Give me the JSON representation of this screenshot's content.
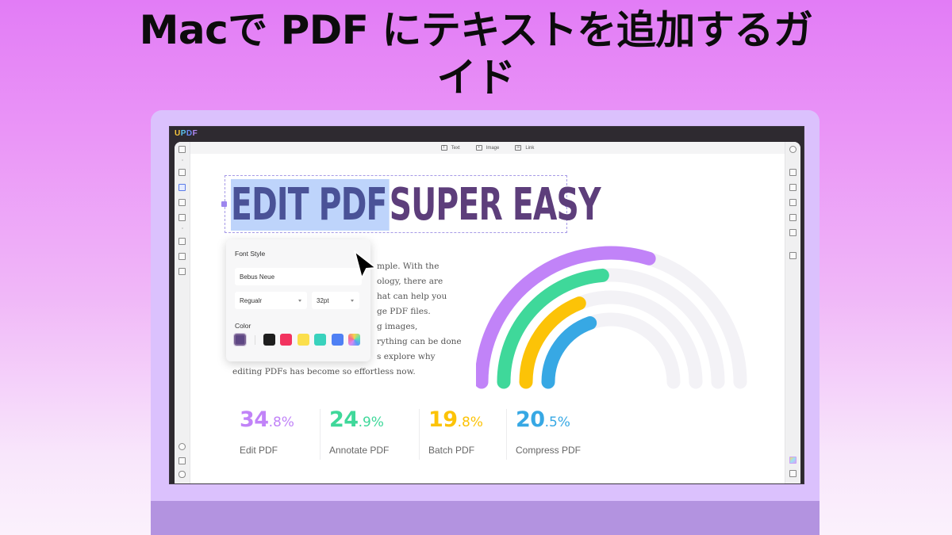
{
  "headline": {
    "line1": "Macで PDF にテキストを追加するガ",
    "line2": "イド"
  },
  "app": {
    "logo": {
      "u": "U",
      "p": "P",
      "d": "D",
      "f": "F"
    },
    "toolbar": [
      {
        "icon": "text-box-icon",
        "glyph": "T",
        "label": "Text"
      },
      {
        "icon": "image-icon",
        "glyph": "▪",
        "label": "Image"
      },
      {
        "icon": "link-icon",
        "glyph": "∞",
        "label": "Link"
      }
    ],
    "left_rail_icons": [
      "thumbnail-icon",
      "highlighter-icon",
      "edit-pdf-icon",
      "organize-pages-icon",
      "convert-icon",
      "crop-icon",
      "protect-icon",
      "form-icon",
      "layers-icon",
      "bookmark-icon",
      "attachment-icon"
    ],
    "right_rail_icons": [
      "search-icon",
      "ocr-icon",
      "convert-pdf-icon",
      "protect-pdf-icon",
      "share-icon",
      "email-icon",
      "save-icon",
      "ai-assistant-icon",
      "comment-icon"
    ]
  },
  "document": {
    "heading_selected": "EDIT PDF",
    "heading_rest": "SUPER EASY",
    "paragraph_lines": [
      "mple. With the",
      "ology, there are",
      "hat can help you",
      "ge PDF files.",
      "g images,",
      "rything can be done",
      "s explore why",
      "editing PDFs has become so effortless now."
    ]
  },
  "font_popover": {
    "title": "Font Style",
    "font_family": "Bebus Neue",
    "font_weight": "Regualr",
    "font_size": "32pt",
    "color_label": "Color",
    "current_color": "#5e4784",
    "swatches": [
      "#1e1e1e",
      "#f2335f",
      "#fbdf4c",
      "#39d2bd",
      "#4f80f4",
      "gradient"
    ]
  },
  "chart_data": {
    "type": "radial-bar",
    "series": [
      {
        "name": "Edit PDF",
        "value": 34.8,
        "color": "#c183f8"
      },
      {
        "name": "Annotate PDF",
        "value": 24.9,
        "color": "#3fd89a"
      },
      {
        "name": "Batch PDF",
        "value": 19.8,
        "color": "#fcc307"
      },
      {
        "name": "Compress PDF",
        "value": 20.5,
        "color": "#37a8e4"
      }
    ],
    "track_color": "#f3f2f6",
    "range": [
      0,
      100
    ]
  },
  "stats": [
    {
      "int": "34",
      "dec": ".8%",
      "label": "Edit PDF",
      "color": "#c183f8"
    },
    {
      "int": "24",
      "dec": ".9%",
      "label": "Annotate PDF",
      "color": "#3fd89a"
    },
    {
      "int": "19",
      "dec": ".8%",
      "label": "Batch PDF",
      "color": "#fcc307"
    },
    {
      "int": "20",
      "dec": ".5%",
      "label": "Compress PDF",
      "color": "#37a8e4"
    }
  ]
}
